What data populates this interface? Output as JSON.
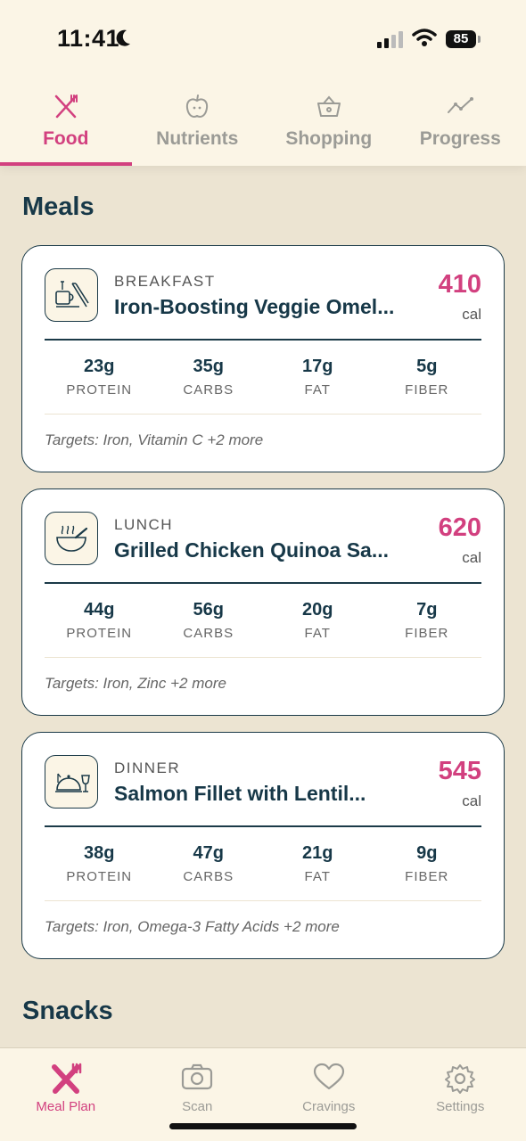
{
  "status_bar": {
    "time": "11:41",
    "battery": "85"
  },
  "top_tabs": [
    {
      "label": "Food",
      "icon": "utensils-icon",
      "active": true
    },
    {
      "label": "Nutrients",
      "icon": "apple-icon",
      "active": false
    },
    {
      "label": "Shopping",
      "icon": "basket-icon",
      "active": false
    },
    {
      "label": "Progress",
      "icon": "trend-line-icon",
      "active": false
    }
  ],
  "meals_title": "Meals",
  "snacks_title": "Snacks",
  "meals": [
    {
      "type": "BREAKFAST",
      "name": "Iron-Boosting Veggie Omel...",
      "calories": "410",
      "cal_unit": "cal",
      "icon": "breakfast-icon",
      "macros": [
        {
          "value": "23g",
          "label": "PROTEIN"
        },
        {
          "value": "35g",
          "label": "CARBS"
        },
        {
          "value": "17g",
          "label": "FAT"
        },
        {
          "value": "5g",
          "label": "FIBER"
        }
      ],
      "targets": "Targets: Iron, Vitamin C +2 more"
    },
    {
      "type": "LUNCH",
      "name": "Grilled Chicken Quinoa Sa...",
      "calories": "620",
      "cal_unit": "cal",
      "icon": "bowl-icon",
      "macros": [
        {
          "value": "44g",
          "label": "PROTEIN"
        },
        {
          "value": "56g",
          "label": "CARBS"
        },
        {
          "value": "20g",
          "label": "FAT"
        },
        {
          "value": "7g",
          "label": "FIBER"
        }
      ],
      "targets": "Targets: Iron, Zinc +2 more"
    },
    {
      "type": "DINNER",
      "name": "Salmon Fillet with Lentil...",
      "calories": "545",
      "cal_unit": "cal",
      "icon": "dinner-icon",
      "macros": [
        {
          "value": "38g",
          "label": "PROTEIN"
        },
        {
          "value": "47g",
          "label": "CARBS"
        },
        {
          "value": "21g",
          "label": "FAT"
        },
        {
          "value": "9g",
          "label": "FIBER"
        }
      ],
      "targets": "Targets: Iron, Omega-3 Fatty Acids +2 more"
    }
  ],
  "bottom_nav": [
    {
      "label": "Meal Plan",
      "icon": "utensils-icon",
      "active": true
    },
    {
      "label": "Scan",
      "icon": "camera-icon",
      "active": false
    },
    {
      "label": "Cravings",
      "icon": "heart-icon",
      "active": false
    },
    {
      "label": "Settings",
      "icon": "gear-icon",
      "active": false
    }
  ],
  "colors": {
    "accent": "#d2407f",
    "dark": "#173848",
    "background": "#ece4d2",
    "surface": "#fbf5e6"
  }
}
